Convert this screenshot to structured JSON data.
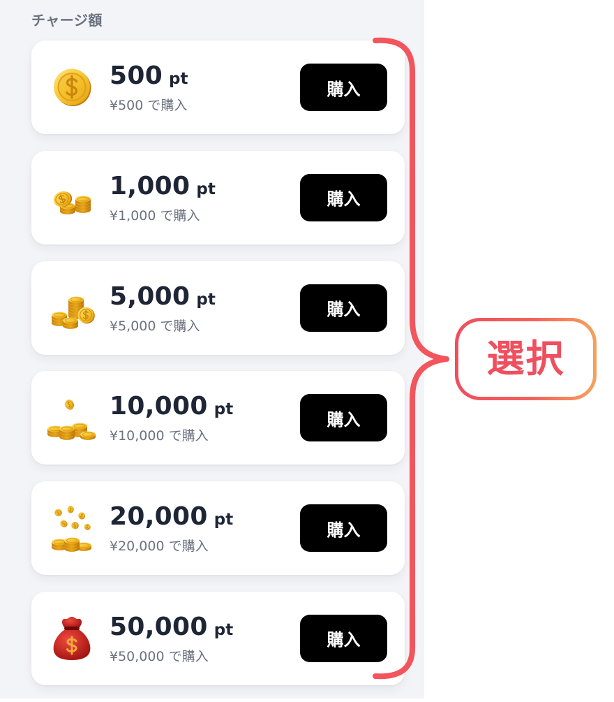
{
  "section": {
    "title": "チャージ額"
  },
  "plans": [
    {
      "amount": "500",
      "unit": "pt",
      "price": "¥500 で購入",
      "button": "購入",
      "icon": "gold-coin-icon"
    },
    {
      "amount": "1,000",
      "unit": "pt",
      "price": "¥1,000 で購入",
      "button": "購入",
      "icon": "coin-stack-icon"
    },
    {
      "amount": "5,000",
      "unit": "pt",
      "price": "¥5,000 で購入",
      "button": "購入",
      "icon": "coin-pile-icon"
    },
    {
      "amount": "10,000",
      "unit": "pt",
      "price": "¥10,000 で購入",
      "button": "購入",
      "icon": "coins-floating-icon"
    },
    {
      "amount": "20,000",
      "unit": "pt",
      "price": "¥20,000 で購入",
      "button": "購入",
      "icon": "coins-falling-icon"
    },
    {
      "amount": "50,000",
      "unit": "pt",
      "price": "¥50,000 で購入",
      "button": "購入",
      "icon": "money-bag-icon"
    }
  ],
  "annotation": {
    "label": "選択",
    "bracket_icon": "curly-brace-icon"
  },
  "colors": {
    "panel_background": "#f3f4f7",
    "card_background": "#ffffff",
    "amount_text": "#1e2636",
    "secondary_text": "#6b7280",
    "button_background": "#000000",
    "button_text": "#ffffff",
    "annotation_red": "#f0545c",
    "annotation_orange": "#f5a35b",
    "coin_gold": "#f7c531",
    "bag_red": "#d42420"
  }
}
